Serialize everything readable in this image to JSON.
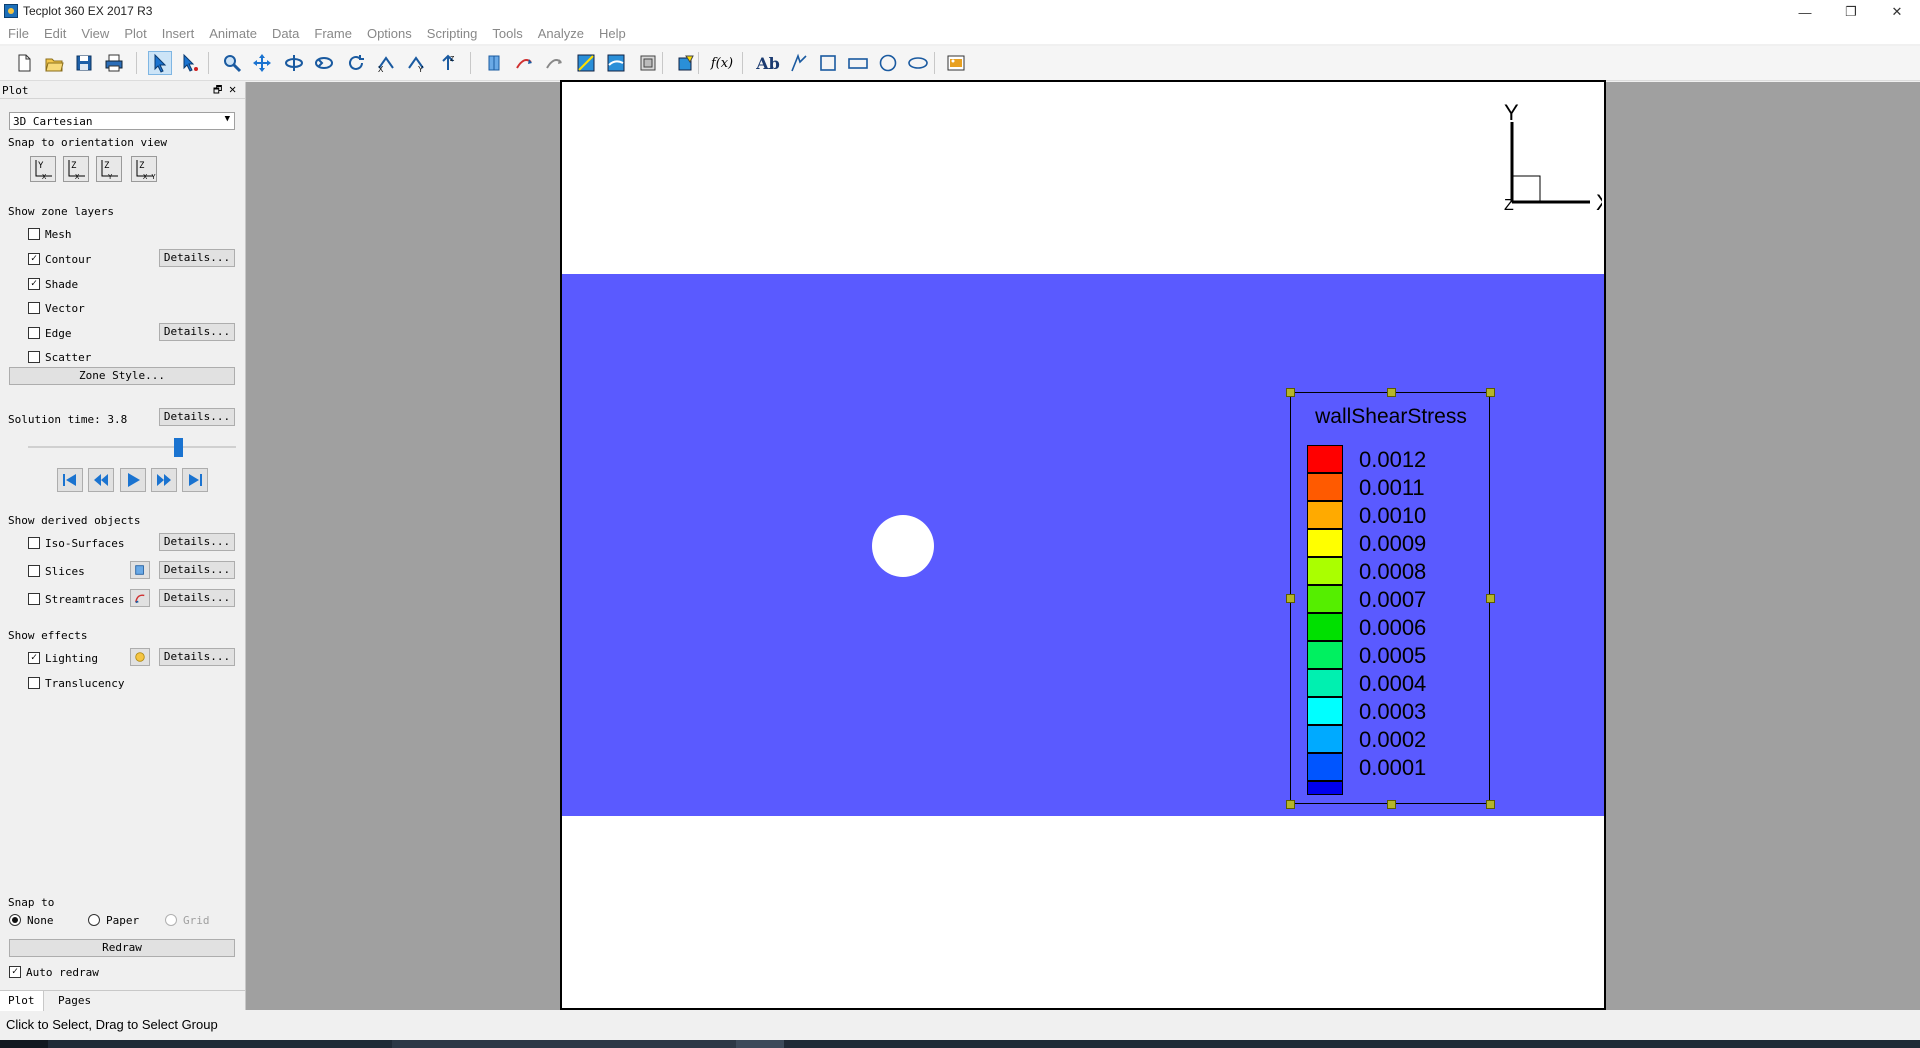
{
  "window": {
    "title": "Tecplot 360 EX 2017 R3",
    "minimize": "—",
    "restore": "❐",
    "close": "✕"
  },
  "menu": [
    "File",
    "Edit",
    "View",
    "Plot",
    "Insert",
    "Animate",
    "Data",
    "Frame",
    "Options",
    "Scripting",
    "Tools",
    "Analyze",
    "Help"
  ],
  "toolbar": {
    "icons": [
      "new-file-icon",
      "open-file-icon",
      "save-icon",
      "print-icon",
      "select-arrow-icon",
      "adjustor-icon",
      "zoom-icon",
      "translate-icon",
      "rotate-spherical-icon",
      "rotate-rollerball-icon",
      "rotate-twist-icon",
      "rotate-x-icon",
      "rotate-y-icon",
      "rotate-z-icon",
      "probe-icon",
      "extract-line-icon",
      "extract-polyline-icon",
      "contour-add-icon",
      "contour-remove-icon",
      "zone-create-icon",
      "geometry-edit-icon",
      "function-icon",
      "text-icon",
      "polyline-icon",
      "square-icon",
      "rectangle-icon",
      "circle-icon",
      "ellipse-icon",
      "image-icon"
    ],
    "text_label": "Ab",
    "fx_label": "f(x)"
  },
  "sidebar": {
    "panel_title": "Plot",
    "float_glyph": "🗗",
    "close_glyph": "✕",
    "plot_type": "3D Cartesian",
    "snap_orient_label": "Snap to orientation view",
    "orient_views": [
      {
        "top": "Y",
        "bottom": "X"
      },
      {
        "top": "Z",
        "bottom": "X"
      },
      {
        "top": "Z",
        "bottom": "Y"
      },
      {
        "top": "Z",
        "bottom": "X Y"
      }
    ],
    "zone_layers_label": "Show zone layers",
    "zone_layers": [
      {
        "label": "Mesh",
        "checked": false
      },
      {
        "label": "Contour",
        "checked": true,
        "details": "Details..."
      },
      {
        "label": "Shade",
        "checked": true
      },
      {
        "label": "Vector",
        "checked": false
      },
      {
        "label": "Edge",
        "checked": false,
        "details": "Details..."
      },
      {
        "label": "Scatter",
        "checked": false
      }
    ],
    "zone_style_button": "Zone Style...",
    "solution_time_label": "Solution time: 3.8",
    "solution_time_details": "Details...",
    "time_position": 0.75,
    "derived_label": "Show derived objects",
    "derived": [
      {
        "label": "Iso-Surfaces",
        "checked": false,
        "details": "Details..."
      },
      {
        "label": "Slices",
        "checked": false,
        "details": "Details..."
      },
      {
        "label": "Streamtraces",
        "checked": false,
        "details": "Details..."
      }
    ],
    "effects_label": "Show effects",
    "effects": [
      {
        "label": "Lighting",
        "checked": true,
        "details": "Details..."
      },
      {
        "label": "Translucency",
        "checked": false
      }
    ],
    "snap_to_label": "Snap to",
    "snap_options": [
      {
        "label": "None",
        "selected": true
      },
      {
        "label": "Paper",
        "selected": false
      },
      {
        "label": "Grid",
        "selected": false
      }
    ],
    "redraw_button": "Redraw",
    "auto_redraw_label": "Auto redraw",
    "auto_redraw_checked": true,
    "tabs": [
      "Plot",
      "Pages"
    ]
  },
  "frame": {
    "axis": {
      "y": "Y",
      "x": "X",
      "z": "Z"
    },
    "legend": {
      "title": "wallShearStress",
      "levels": [
        {
          "label": "0.0012",
          "color": "#ff0000"
        },
        {
          "label": "0.0011",
          "color": "#ff5a00"
        },
        {
          "label": "0.0010",
          "color": "#ffaa00"
        },
        {
          "label": "0.0009",
          "color": "#ffff00"
        },
        {
          "label": "0.0008",
          "color": "#aaff00"
        },
        {
          "label": "0.0007",
          "color": "#55ee00"
        },
        {
          "label": "0.0006",
          "color": "#00e000"
        },
        {
          "label": "0.0005",
          "color": "#00f060"
        },
        {
          "label": "0.0004",
          "color": "#00f0b0"
        },
        {
          "label": "0.0003",
          "color": "#00ffff"
        },
        {
          "label": "0.0002",
          "color": "#00aaff"
        },
        {
          "label": "0.0001",
          "color": "#0055ff"
        }
      ],
      "bottom_color": "#0000ee"
    },
    "flow_color": "#5a5aff"
  },
  "status": {
    "text": "Click to Select, Drag to Select Group"
  }
}
